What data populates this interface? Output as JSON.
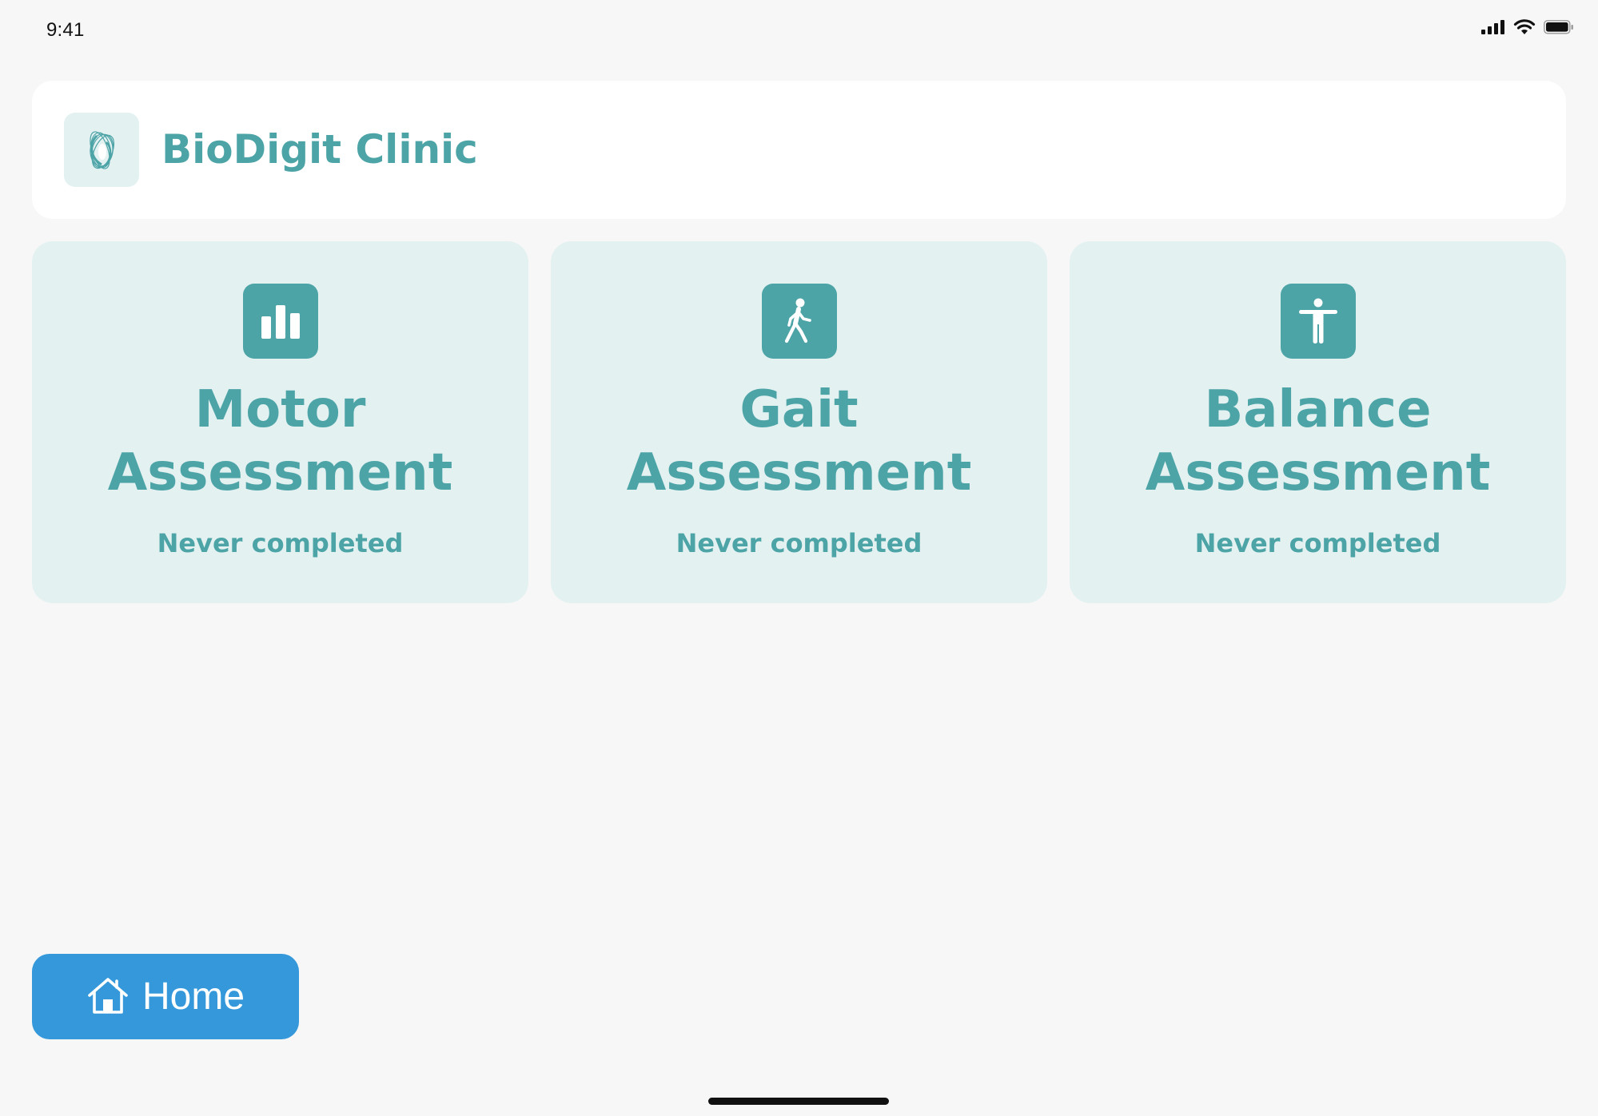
{
  "status_bar": {
    "time": "9:41",
    "icons": [
      "signal-icon",
      "wifi-icon",
      "battery-icon"
    ]
  },
  "header": {
    "logo_icon": "biodigit-logo-icon",
    "title": "BioDigit Clinic"
  },
  "assessments": [
    {
      "icon": "bar-chart-icon",
      "title": "Motor\nAssessment",
      "status": "Never completed"
    },
    {
      "icon": "walking-person-icon",
      "title": "Gait\nAssessment",
      "status": "Never completed"
    },
    {
      "icon": "balance-person-icon",
      "title": "Balance\nAssessment",
      "status": "Never completed"
    }
  ],
  "nav": {
    "home_icon": "home-icon",
    "home_label": "Home"
  },
  "colors": {
    "accent": "#4da4a7",
    "card_background": "#e3f1f1",
    "page_background": "#f7f7f7",
    "home_button": "#3498db"
  }
}
